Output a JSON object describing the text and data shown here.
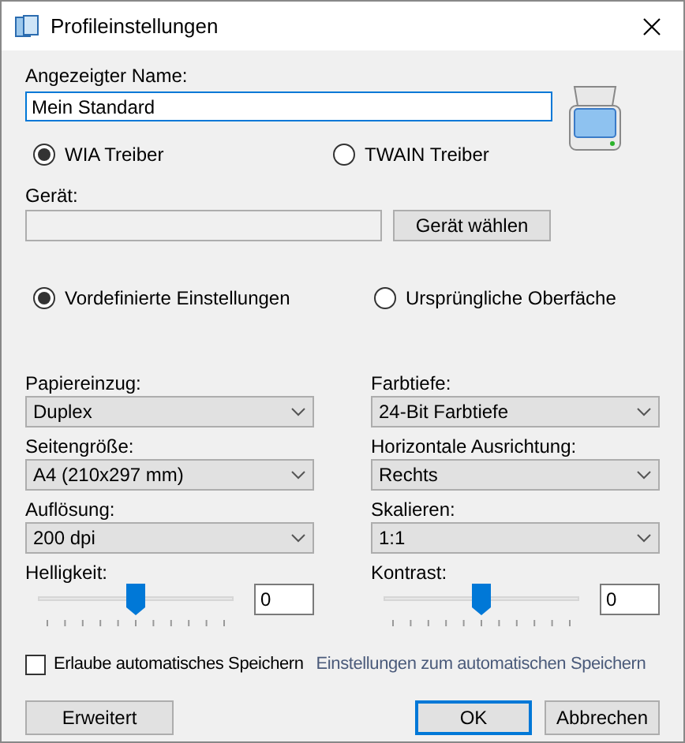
{
  "window": {
    "title": "Profileinstellungen"
  },
  "display_name": {
    "label": "Angezeigter Name:",
    "value": "Mein Standard"
  },
  "driver_options": [
    {
      "label": "WIA Treiber",
      "selected": true
    },
    {
      "label": "TWAIN Treiber",
      "selected": false
    }
  ],
  "device": {
    "label": "Gerät:",
    "button": "Gerät wählen"
  },
  "mode_options": [
    {
      "label": "Vordefinierte Einstellungen",
      "selected": true
    },
    {
      "label": "Ursprüngliche Oberfäche",
      "selected": false
    }
  ],
  "left_settings": [
    {
      "kind": "select",
      "label": "Papiereinzug:",
      "value": "Duplex"
    },
    {
      "kind": "select",
      "label": "Seitengröße:",
      "value": "A4 (210x297 mm)"
    },
    {
      "kind": "select",
      "label": "Auflösung:",
      "value": "200 dpi"
    },
    {
      "kind": "slider",
      "label": "Helligkeit:",
      "level": 0.5,
      "value": "0"
    }
  ],
  "right_settings": [
    {
      "kind": "select",
      "label": "Farbtiefe:",
      "value": "24-Bit Farbtiefe"
    },
    {
      "kind": "select",
      "label": "Horizontale Ausrichtung:",
      "value": "Rechts"
    },
    {
      "kind": "select",
      "label": "Skalieren:",
      "value": "1:1"
    },
    {
      "kind": "slider",
      "label": "Kontrast:",
      "level": 0.5,
      "value": "0"
    }
  ],
  "autosave": {
    "label": "Erlaube automatisches Speichern",
    "checked": false,
    "link": "Einstellungen zum automatischen Speichern"
  },
  "buttons": {
    "advanced": "Erweitert",
    "ok": "OK",
    "cancel": "Abbrechen"
  }
}
